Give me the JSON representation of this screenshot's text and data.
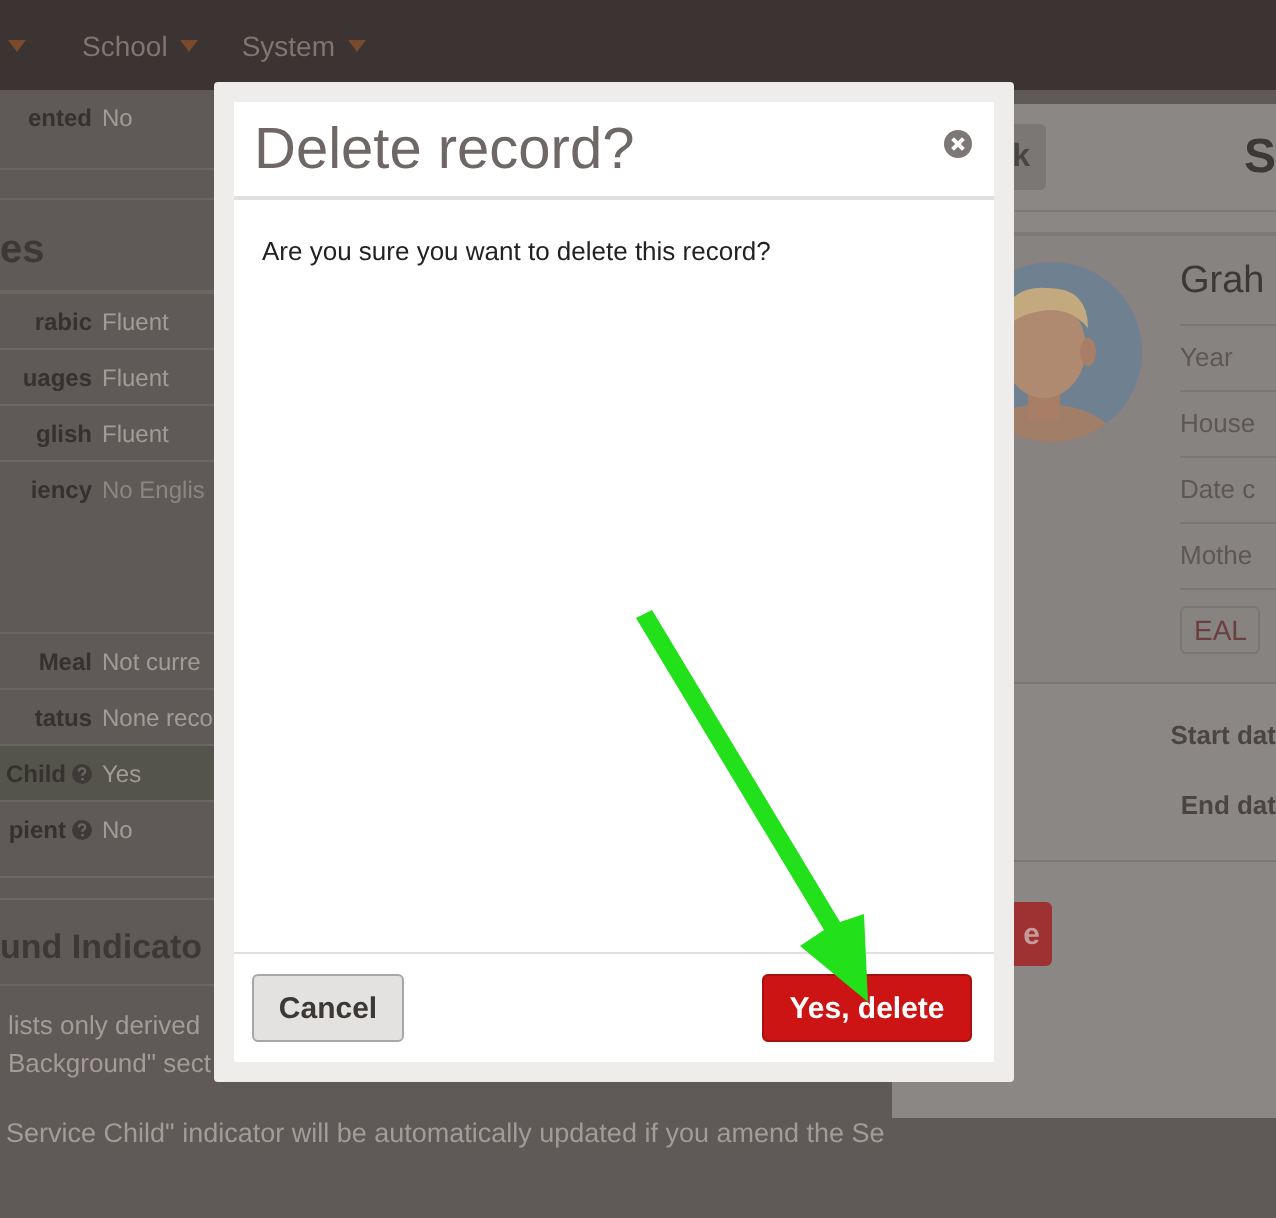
{
  "nav": {
    "menus": [
      {
        "label": "School"
      },
      {
        "label": "System"
      }
    ]
  },
  "left_panel": {
    "top_rows": [
      {
        "label": "ented",
        "value": "No",
        "muted": false,
        "help": false,
        "highlighted": false
      }
    ],
    "languages_heading": "es",
    "language_rows": [
      {
        "label": "rabic",
        "value": "Fluent",
        "muted": false,
        "help": false,
        "highlighted": false
      },
      {
        "label": "uages",
        "value": "Fluent",
        "muted": false,
        "help": false,
        "highlighted": false
      },
      {
        "label": "glish",
        "value": "Fluent",
        "muted": false,
        "help": false,
        "highlighted": false
      },
      {
        "label": "iency",
        "value": "No Englis",
        "muted": true,
        "help": false,
        "highlighted": false
      }
    ],
    "welfare_rows": [
      {
        "label": "Meal",
        "value": "Not curre",
        "muted": false,
        "help": false,
        "highlighted": false
      },
      {
        "label": "tatus",
        "value": "None reco",
        "muted": false,
        "help": false,
        "highlighted": false
      },
      {
        "label": "Child",
        "value": "Yes",
        "muted": false,
        "help": true,
        "highlighted": true
      },
      {
        "label": "pient",
        "value": "No",
        "muted": false,
        "help": true,
        "highlighted": false
      }
    ],
    "background_heading": "und Indicato",
    "notes": [
      "lists only derived",
      "Background\" sect"
    ],
    "footer_note": "Service Child\" indicator will be automatically updated if you amend the Se"
  },
  "right_panel": {
    "back_button": "k",
    "heading": "S",
    "student": {
      "name": "Grah",
      "fields": [
        "Year",
        "House",
        "Date c",
        "Mothe"
      ],
      "tags": [
        "EAL"
      ]
    },
    "dates": [
      "Start dat",
      "End dat"
    ],
    "delete_button": "e"
  },
  "modal": {
    "title": "Delete record?",
    "message": "Are you sure you want to delete this record?",
    "buttons": [
      {
        "label": "Cancel",
        "kind": "secondary"
      },
      {
        "label": "Yes, delete",
        "kind": "danger"
      }
    ]
  }
}
